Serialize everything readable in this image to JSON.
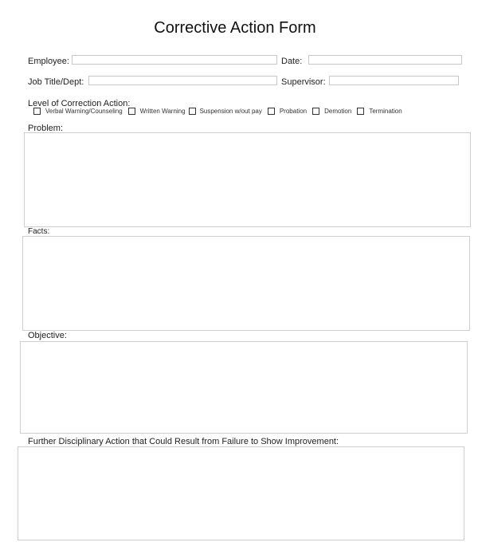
{
  "title": "Corrective Action Form",
  "fields": {
    "employee": {
      "label": "Employee:",
      "value": ""
    },
    "date": {
      "label": "Date:",
      "value": ""
    },
    "job_title": {
      "label": "Job Title/Dept:",
      "value": ""
    },
    "supervisor": {
      "label": "Supervisor:",
      "value": ""
    }
  },
  "correction": {
    "label": "Level of Correction Action:",
    "options": [
      {
        "label": "Verbal Warning/Counseling",
        "checked": false
      },
      {
        "label": "Written Warning",
        "checked": false
      },
      {
        "label": "Suspension w/out pay",
        "checked": false
      },
      {
        "label": "Probation",
        "checked": false
      },
      {
        "label": "Demotion",
        "checked": false
      },
      {
        "label": "Termination",
        "checked": false
      }
    ]
  },
  "sections": {
    "problem": {
      "label": "Problem:",
      "value": ""
    },
    "facts": {
      "label": "Facts:",
      "value": ""
    },
    "objective": {
      "label": "Objective:",
      "value": ""
    },
    "further": {
      "label": "Further Disciplinary Action that Could Result from Failure to Show Improvement:",
      "value": ""
    }
  }
}
